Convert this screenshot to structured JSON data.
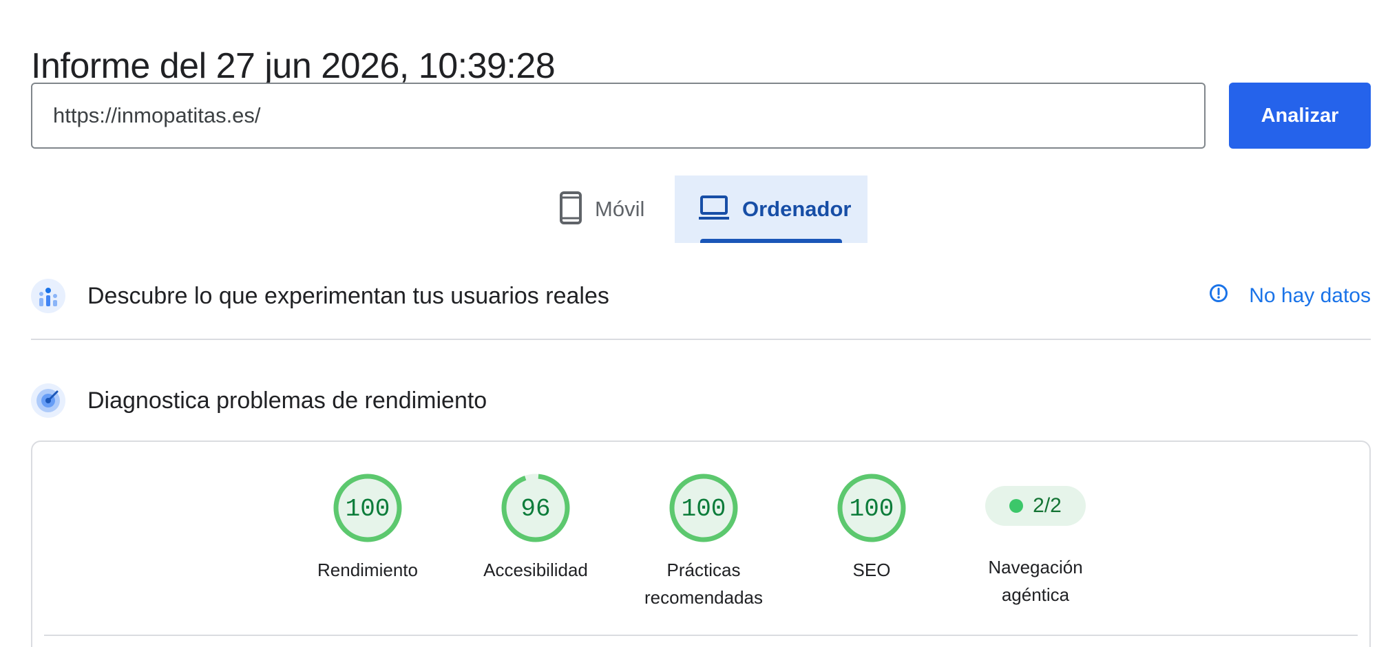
{
  "report": {
    "title": "Informe del 27 jun 2026, 10:39:28"
  },
  "search": {
    "url_value": "https://inmopatitas.es/",
    "analyze_label": "Analizar"
  },
  "device_tabs": {
    "mobile_label": "Móvil",
    "desktop_label": "Ordenador",
    "selected": "Ordenador"
  },
  "field_data": {
    "title": "Descubre lo que experimentan tus usuarios reales",
    "status": "No hay datos",
    "status_icon": "info-icon",
    "section_icon": "users-chart-icon"
  },
  "lab_data": {
    "title": "Diagnostica problemas de rendimiento",
    "section_icon": "radar-icon"
  },
  "scores": [
    {
      "label": "Rendimiento",
      "value": "100",
      "fraction": 1.0
    },
    {
      "label": "Accesibilidad",
      "value": "96",
      "fraction": 0.96
    },
    {
      "label": "Prácticas recomendadas",
      "value": "100",
      "fraction": 1.0
    },
    {
      "label": "SEO",
      "value": "100",
      "fraction": 1.0
    }
  ],
  "agentic": {
    "label": "Navegación agéntica",
    "value": "2/2"
  },
  "colors": {
    "primary_blue": "#2563eb",
    "score_green": "#0c7c3a",
    "gauge_ring": "#5cc86e",
    "gauge_fill": "#e6f4ea"
  }
}
